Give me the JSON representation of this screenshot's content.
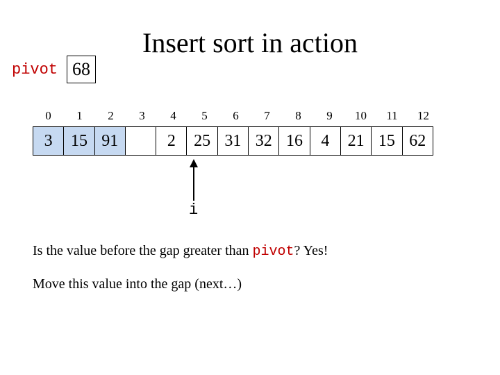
{
  "title": "Insert sort in action",
  "pivot_label": "pivot",
  "pivot_value": "68",
  "indices": [
    "0",
    "1",
    "2",
    "3",
    "4",
    "5",
    "6",
    "7",
    "8",
    "9",
    "10",
    "11",
    "12"
  ],
  "cells": [
    {
      "v": "3",
      "sorted": true
    },
    {
      "v": "15",
      "sorted": true
    },
    {
      "v": "91",
      "sorted": true
    },
    {
      "v": "",
      "sorted": false,
      "gap": true
    },
    {
      "v": "2",
      "sorted": false
    },
    {
      "v": "25",
      "sorted": false
    },
    {
      "v": "31",
      "sorted": false
    },
    {
      "v": "32",
      "sorted": false
    },
    {
      "v": "16",
      "sorted": false
    },
    {
      "v": "4",
      "sorted": false
    },
    {
      "v": "21",
      "sorted": false
    },
    {
      "v": "15",
      "sorted": false
    },
    {
      "v": "62",
      "sorted": false
    }
  ],
  "i_label": "i",
  "line1_pre": "Is the value before the gap greater than ",
  "line1_kw": "pivot",
  "line1_post": "? Yes!",
  "line2": "Move this value into the gap (next…)"
}
